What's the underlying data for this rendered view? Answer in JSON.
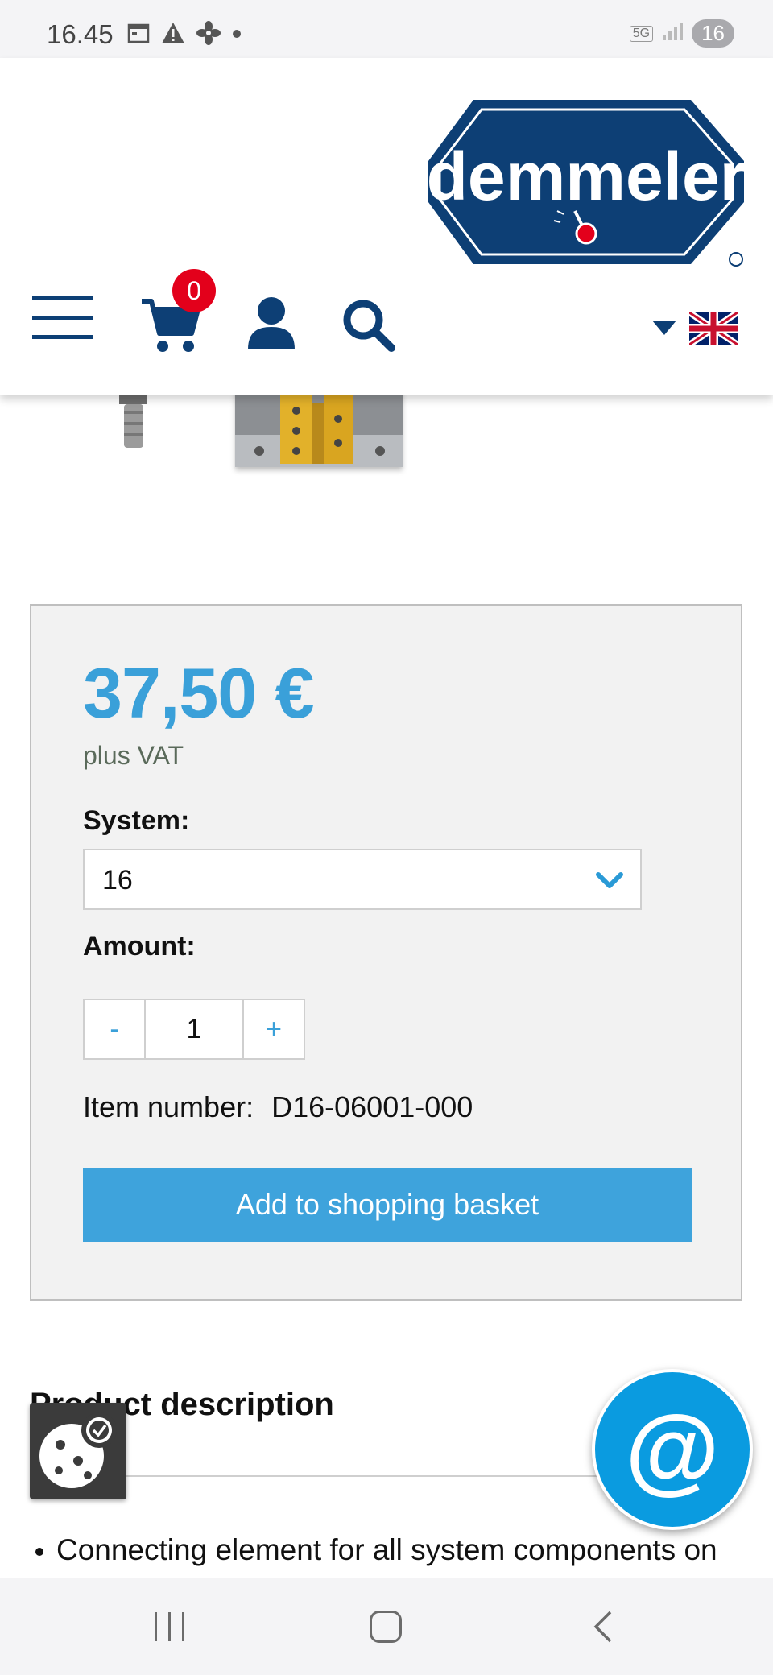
{
  "status_bar": {
    "time": "16.45",
    "network": "5G",
    "battery": "16"
  },
  "header": {
    "logo_text": "demmeler",
    "cart_count": "0",
    "language": "English"
  },
  "product": {
    "price": "37,50 €",
    "vat_note": "plus VAT",
    "system_label": "System:",
    "system_value": "16",
    "amount_label": "Amount:",
    "qty_minus": "-",
    "qty_value": "1",
    "qty_plus": "+",
    "item_number_label": "Item number:",
    "item_number_value": "D16-06001-000",
    "add_button": "Add to shopping basket"
  },
  "description": {
    "title": "Product description",
    "bullet_1": "Connecting element for all system components on"
  },
  "chat": {
    "symbol": "@"
  },
  "colors": {
    "brand_navy": "#0d3f75",
    "accent_blue": "#3aa0d9",
    "badge_red": "#e3001b"
  }
}
